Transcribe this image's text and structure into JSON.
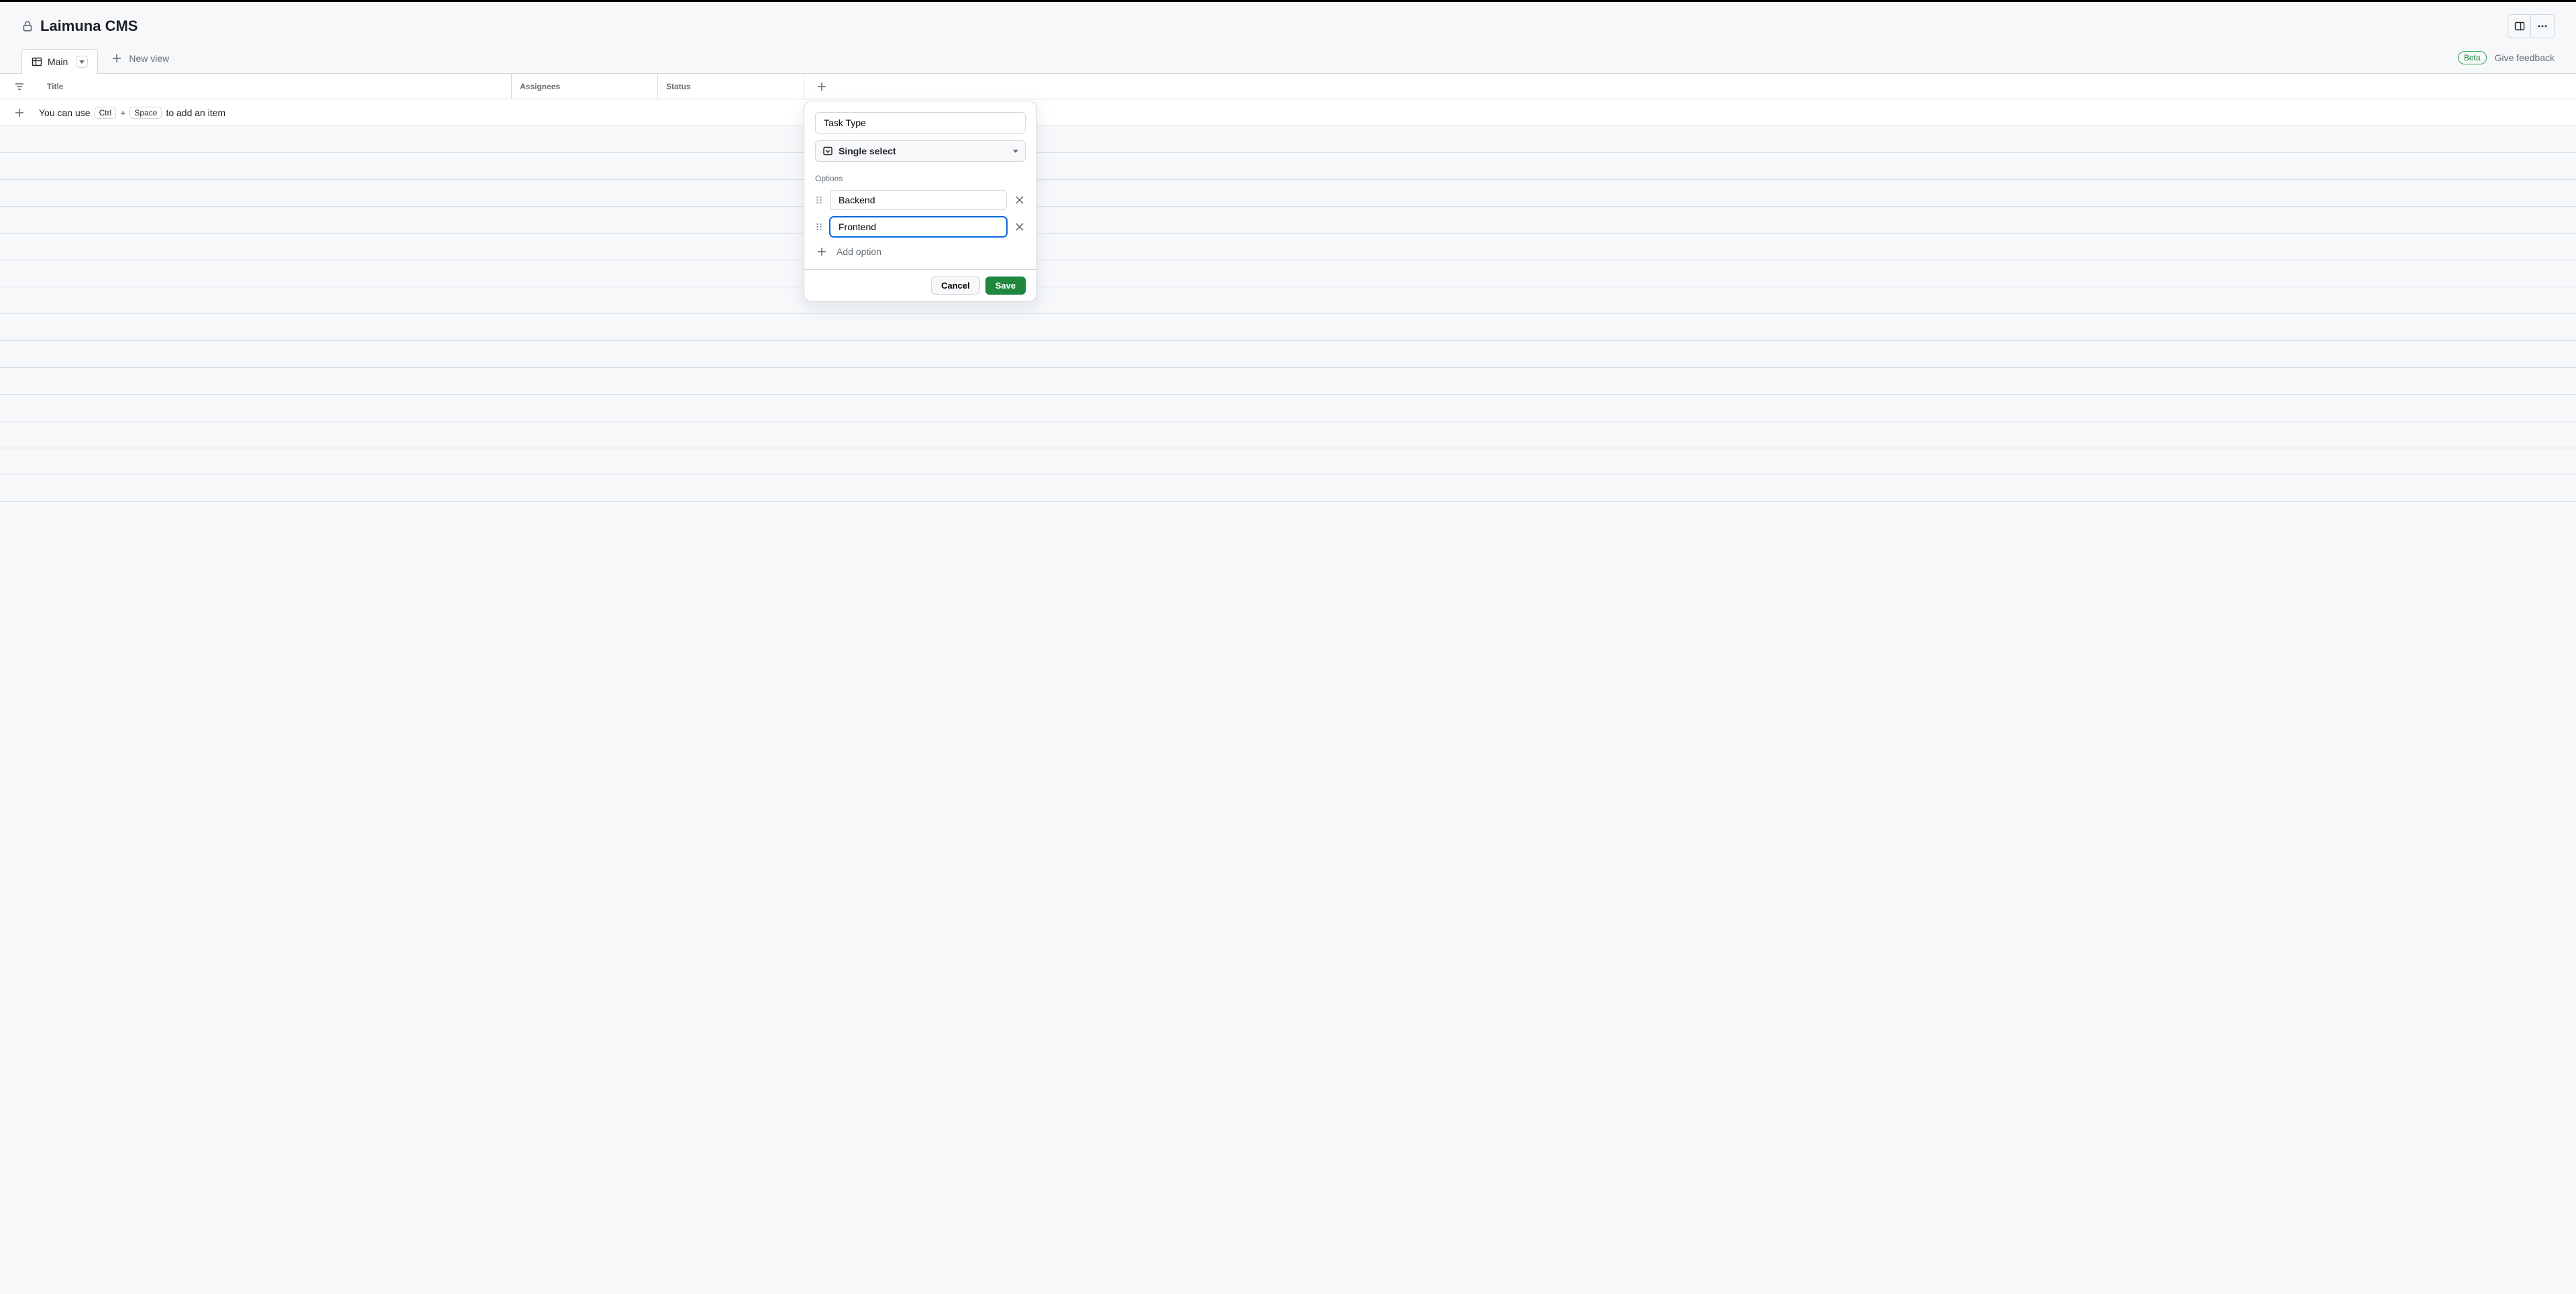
{
  "header": {
    "title": "Laimuna CMS"
  },
  "tabs": {
    "active_label": "Main",
    "new_view_label": "New view"
  },
  "toolbar": {
    "beta_label": "Beta",
    "feedback_label": "Give feedback"
  },
  "columns": {
    "title": "Title",
    "assignees": "Assignees",
    "status": "Status"
  },
  "add_item_hint": {
    "prefix": "You can use",
    "key1": "Ctrl",
    "plus": "+",
    "key2": "Space",
    "suffix": "to add an item"
  },
  "popover": {
    "field_name": "Task Type",
    "type_label": "Single select",
    "options_label": "Options",
    "options": [
      {
        "value": "Backend",
        "focused": false
      },
      {
        "value": "Frontend",
        "focused": true
      }
    ],
    "add_option_label": "Add option",
    "cancel_label": "Cancel",
    "save_label": "Save"
  }
}
